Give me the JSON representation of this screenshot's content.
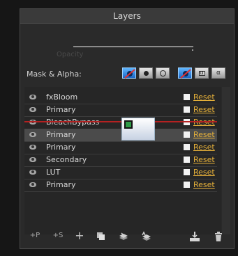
{
  "window": {
    "title": "Layers"
  },
  "opacity": {
    "label": "Opacity",
    "value": 0.99
  },
  "mask_alpha": {
    "label": "Mask & Alpha:",
    "mask_buttons": [
      {
        "icon": "no-mask-icon",
        "active": true
      },
      {
        "icon": "filled-circle-mask-icon",
        "active": false
      },
      {
        "icon": "ring-mask-icon",
        "active": false
      }
    ],
    "alpha_buttons": [
      {
        "icon": "no-alpha-icon",
        "active": true
      },
      {
        "icon": "alpha-box-icon",
        "glyph": "α",
        "active": false
      },
      {
        "icon": "alpha-icon",
        "glyph": "α",
        "active": false
      }
    ]
  },
  "layers": [
    {
      "name": "fxBloom",
      "reset": "Reset",
      "selected": false
    },
    {
      "name": "Primary",
      "reset": "Reset",
      "selected": false
    },
    {
      "name": "BleachBypass",
      "reset": "Reset",
      "selected": false
    },
    {
      "name": "Primary",
      "reset": "Reset",
      "selected": true
    },
    {
      "name": "Primary",
      "reset": "Reset",
      "selected": false
    },
    {
      "name": "Secondary",
      "reset": "Reset",
      "selected": false
    },
    {
      "name": "LUT",
      "reset": "Reset",
      "selected": false
    },
    {
      "name": "Primary",
      "reset": "Reset",
      "selected": false
    }
  ],
  "toolbar": {
    "add_primary": "+P",
    "add_secondary": "+S",
    "add": "+",
    "duplicate_icon": "duplicate-icon",
    "merge_down_icon": "merge-down-icon",
    "merge_up_icon": "merge-up-icon",
    "import_icon": "import-icon",
    "delete_icon": "trash-icon"
  },
  "colors": {
    "accent_reset": "#e8b23a",
    "drop_indicator": "#b42121",
    "active_button": "#2f86e0"
  }
}
